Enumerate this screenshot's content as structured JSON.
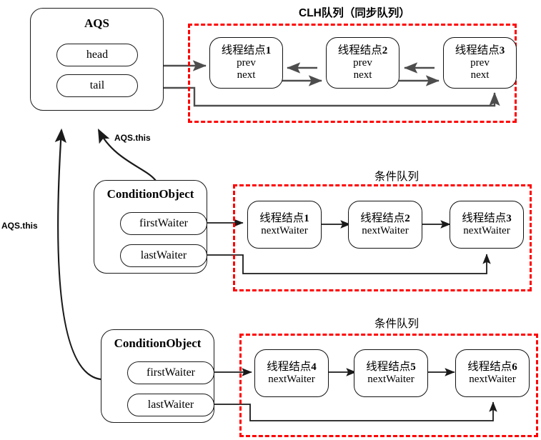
{
  "diagram": {
    "title_clh": "CLH队列（同步队列）",
    "title_condition_1": "条件队列",
    "title_condition_2": "条件队列",
    "aqs": {
      "title": "AQS",
      "fields": [
        {
          "label": "head"
        },
        {
          "label": "tail"
        }
      ]
    },
    "condition_objects": [
      {
        "title": "ConditionObject",
        "fields": [
          {
            "label": "firstWaiter"
          },
          {
            "label": "lastWaiter"
          }
        ]
      },
      {
        "title": "ConditionObject",
        "fields": [
          {
            "label": "firstWaiter"
          },
          {
            "label": "lastWaiter"
          }
        ]
      }
    ],
    "clh_nodes": [
      {
        "name": "线程结点",
        "index": "1",
        "fields": [
          "prev",
          "next"
        ]
      },
      {
        "name": "线程结点",
        "index": "2",
        "fields": [
          "prev",
          "next"
        ]
      },
      {
        "name": "线程结点",
        "index": "3",
        "fields": [
          "prev",
          "next"
        ]
      }
    ],
    "condition_nodes_1": [
      {
        "name": "线程结点",
        "index": "1",
        "fields": [
          "nextWaiter"
        ]
      },
      {
        "name": "线程结点",
        "index": "2",
        "fields": [
          "nextWaiter"
        ]
      },
      {
        "name": "线程结点",
        "index": "3",
        "fields": [
          "nextWaiter"
        ]
      }
    ],
    "condition_nodes_2": [
      {
        "name": "线程结点",
        "index": "4",
        "fields": [
          "nextWaiter"
        ]
      },
      {
        "name": "线程结点",
        "index": "5",
        "fields": [
          "nextWaiter"
        ]
      },
      {
        "name": "线程结点",
        "index": "6",
        "fields": [
          "nextWaiter"
        ]
      }
    ],
    "edge_labels": {
      "aqs_this_top": "AQS.this",
      "aqs_this_left": "AQS.this"
    },
    "colors": {
      "queue_border": "#ff0000",
      "box_border": "#1a1a1a",
      "wire": "#4d4d4d",
      "wire_dark": "#111111",
      "background": "#ffffff"
    }
  }
}
